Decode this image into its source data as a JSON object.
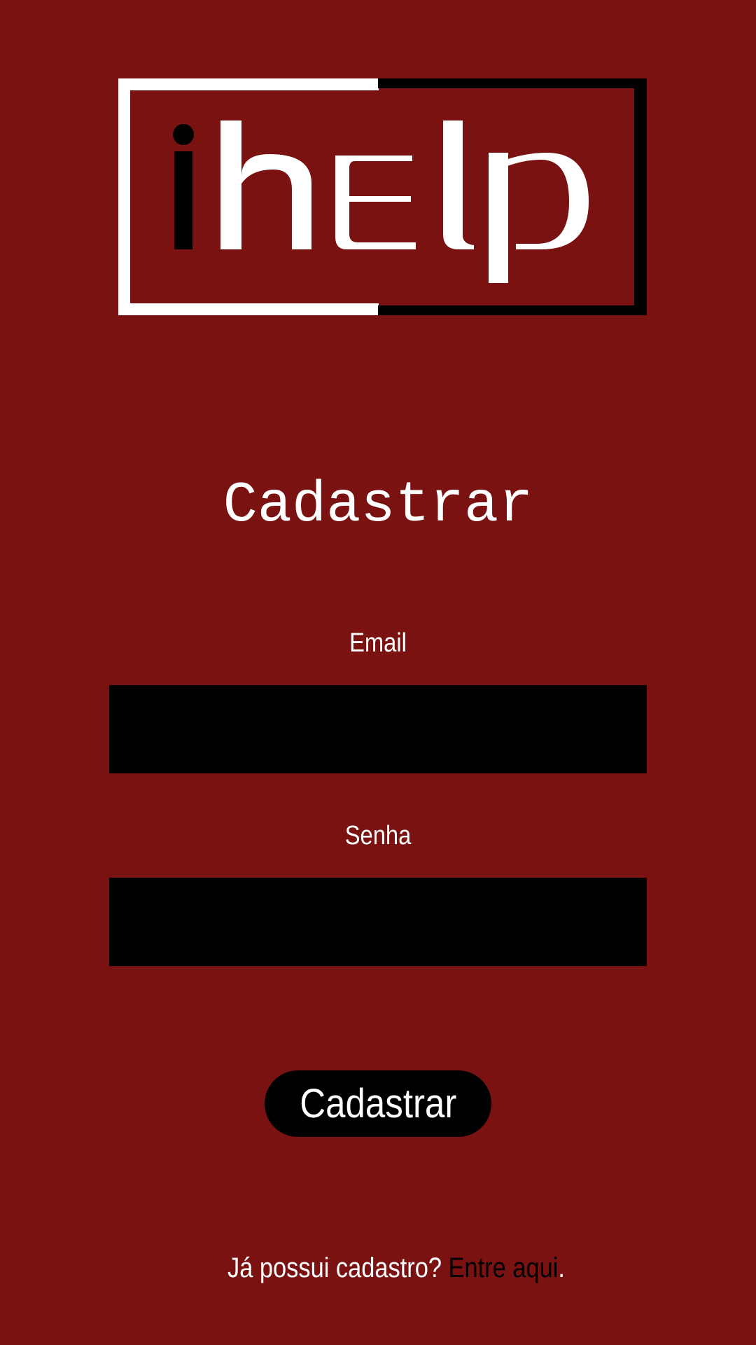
{
  "logo": {
    "text": "ihelp",
    "colors": {
      "primary": "#ffffff",
      "secondary": "#000000"
    }
  },
  "form": {
    "title": "Cadastrar",
    "email_label": "Email",
    "email_value": "",
    "password_label": "Senha",
    "password_value": "",
    "submit_label": "Cadastrar"
  },
  "footer": {
    "prompt": "Já possui cadastro? ",
    "link_label": "Entre aqui",
    "suffix": "."
  },
  "colors": {
    "background": "#7a1212",
    "input_background": "#000000",
    "text": "#ffffff",
    "link": "#000000"
  }
}
